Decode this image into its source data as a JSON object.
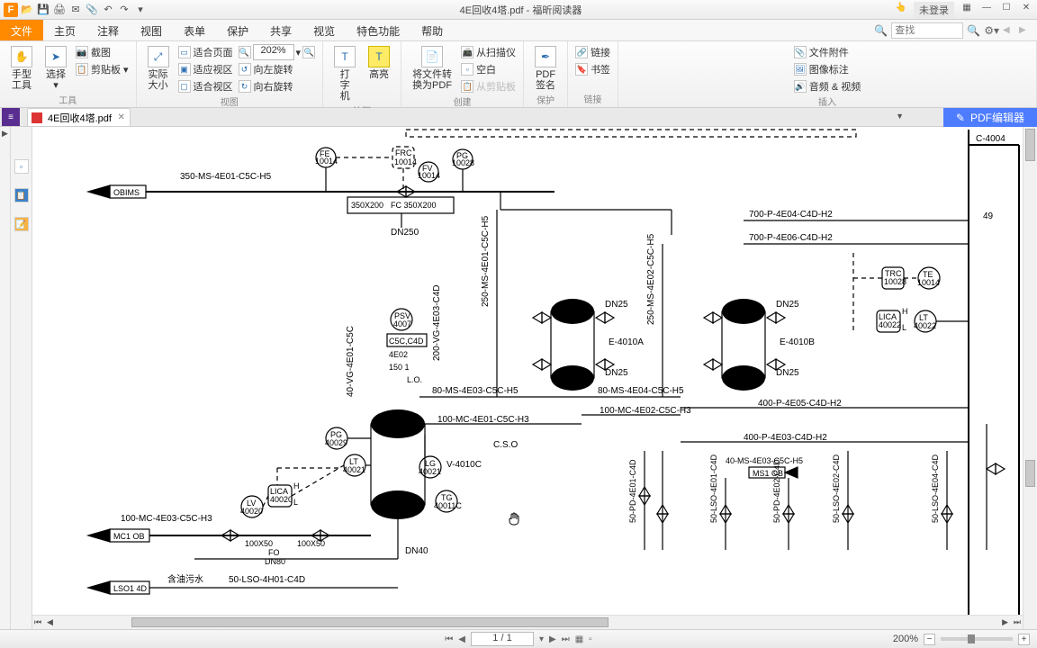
{
  "titlebar": {
    "title": "4E回收4塔.pdf - 福昕阅读器",
    "login": "未登录"
  },
  "menu": {
    "file": "文件",
    "home": "主页",
    "comment": "注释",
    "view": "视图",
    "form": "表单",
    "protect": "保护",
    "share": "共享",
    "read": "视览",
    "special": "特色功能",
    "help": "帮助",
    "search_placeholder": "查找"
  },
  "ribbon": {
    "hand": "手型",
    "hand2": "工具",
    "select": "选择",
    "screenshot": "截图",
    "clipboard": "剪贴板",
    "fitpage": "适合页面",
    "actual": "实际",
    "actual2": "大小",
    "fitcontent": "适应视区",
    "fitview": "适合视区",
    "rotl": "向左旋转",
    "rotr": "向右旋转",
    "zoom_value": "202%",
    "typewriter": "打",
    "typewriter2": "字",
    "typewriter3": "机",
    "highlight": "高亮",
    "convert1": "将文件转",
    "convert2": "换为PDF",
    "scan": "从扫描仪",
    "blank": "空白",
    "from_clip": "从剪贴板",
    "pdfsign": "PDF",
    "pdfsign2": "签名",
    "link": "链接",
    "bookmark": "书签",
    "attach": "文件附件",
    "imgann": "图像标注",
    "av": "音频 & 视频",
    "g_tools": "工具",
    "g_view": "视图",
    "g_annot": "注释",
    "g_create": "创建",
    "g_protect": "保护",
    "g_link": "链接",
    "g_insert": "插入"
  },
  "tab": {
    "name": "4E回收4塔.pdf",
    "editor": "PDF编辑器"
  },
  "diagram": {
    "obims": "OBIMS",
    "mciob": "MC1 OB",
    "lso4d": "LSO1 4D",
    "ms1ob": "MS1 OB",
    "l350": "350-MS-4E01-C5C-H5",
    "fe": "FE",
    "fe_n": "10014",
    "frc": "FRC",
    "frc_n": "10014",
    "fv": "FV",
    "fv_n": "10014",
    "pg1": "PG",
    "pg1_n": "10028",
    "r350": "350X200",
    "fc350": "FC 350X200",
    "dn250": "DN250",
    "p700a": "700-P-4E04-C4D-H2",
    "p700b": "700-P-4E06-C4D-H2",
    "c4004": "C-4004",
    "n49": "49",
    "trc": "TRC",
    "trc_n": "10028",
    "te": "TE",
    "te_n": "10014",
    "lica_r": "LICA",
    "lica_rn": "40022",
    "lt_r": "LT",
    "lt_rn": "40022",
    "H": "H",
    "L": "L",
    "v250": "250-MS-4E01-C5C-H5",
    "v250b": "250-MS-4E02-C5C-H5",
    "vg200": "200-VG-4E03-C4D",
    "vg40": "40-VG-4E01-C5C",
    "psv": "PSV",
    "psv_n": "4007",
    "c5cc4d": "C5C,C4D",
    "e402": "4E02",
    "l150": "150 1",
    "lo": "L.O.",
    "e4010a": "E-4010A",
    "e4010b": "E-4010B",
    "dn25": "DN25",
    "ms80": "80-MS-4E03-C5C-H5",
    "ms80b": "80-MS-4E04-C5C-H5",
    "mc100a": "100-MC-4E01-C5C-H3",
    "mc100b": "100-MC-4E02-C5C-H3",
    "p400a": "400-P-4E05-C4D-H2",
    "p400b": "400-P-4E03-C4D-H2",
    "ms40r": "40-MS-4E03-C5C-H5",
    "pg2": "PG",
    "pg2_n": "40029",
    "lt": "LT",
    "lt_n": "40021",
    "lg": "LG",
    "lg_n": "40021",
    "tg": "TG",
    "tg_n": "40011C",
    "v4010c": "V-4010C",
    "cso": "C.S.O",
    "lica": "LICA",
    "lica_n": "40020",
    "lv": "LV",
    "lv_n": "40020",
    "mc100": "100-MC-4E03-C5C-H3",
    "n100x50": "100X50",
    "fo": "FO",
    "dn80": "DN80",
    "n100x50b": "100X50",
    "dn40": "DN40",
    "oily": "含油污水",
    "lso50": "50-LSO-4H01-C4D",
    "pd50a": "50-PD-4E01-C4D",
    "pd50b": "50-PD-4E02-C4D",
    "lso50a": "50-LSO-4E01-C4D",
    "lso50b": "50-LSO-4E02-C4D",
    "lso50c": "50-LSO-4E04-C4D"
  },
  "status": {
    "page": "1 / 1",
    "zoom": "200%"
  }
}
